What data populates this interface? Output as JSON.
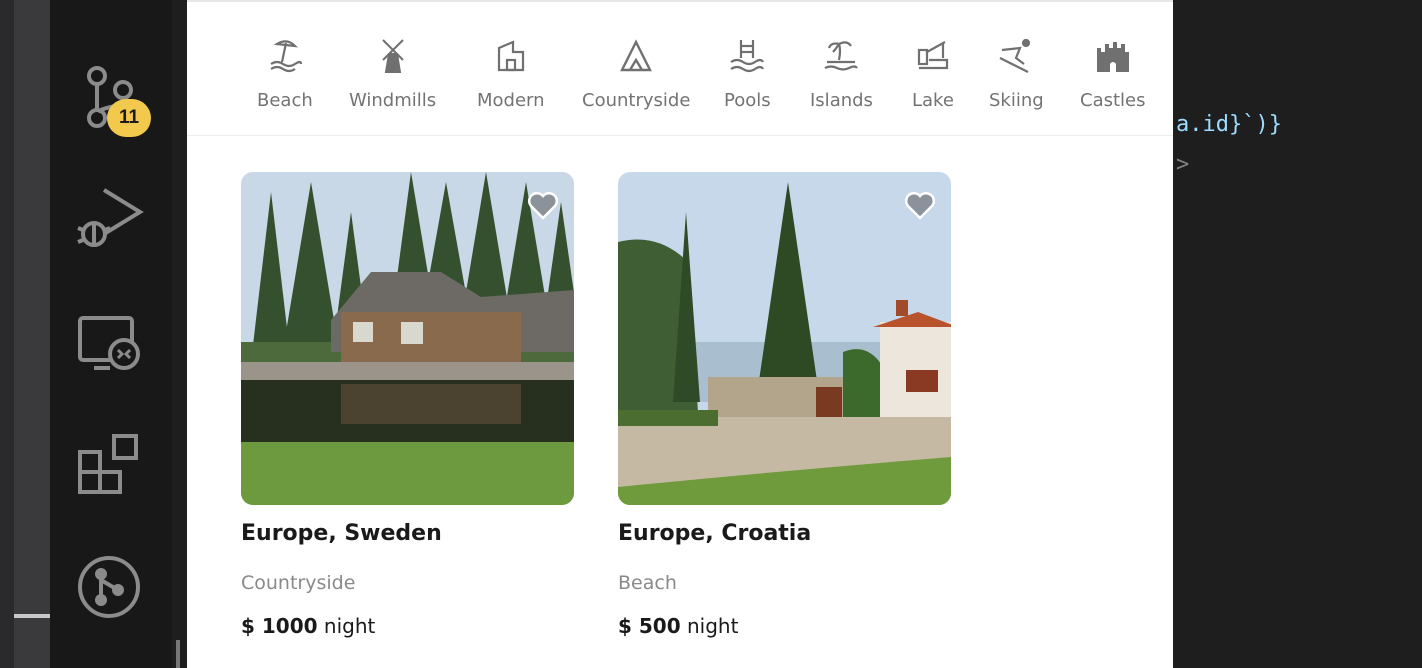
{
  "activity_bar": {
    "source_control_badge": "11",
    "icons": [
      "source-control-icon",
      "run-debug-icon",
      "remote-explorer-icon",
      "extensions-icon",
      "git-graph-icon"
    ]
  },
  "preview": {
    "categories": [
      {
        "label": "Beach",
        "icon": "beach-icon"
      },
      {
        "label": "Windmills",
        "icon": "windmill-icon"
      },
      {
        "label": "Modern",
        "icon": "modern-building-icon"
      },
      {
        "label": "Countryside",
        "icon": "mountain-icon"
      },
      {
        "label": "Pools",
        "icon": "pool-icon"
      },
      {
        "label": "Islands",
        "icon": "island-icon"
      },
      {
        "label": "Lake",
        "icon": "lake-icon"
      },
      {
        "label": "Skiing",
        "icon": "skiing-icon"
      },
      {
        "label": "Castles",
        "icon": "castle-icon"
      }
    ],
    "listings": [
      {
        "location": "Europe, Sweden",
        "category": "Countryside",
        "price": "$ 1000",
        "unit": "night"
      },
      {
        "location": "Europe, Croatia",
        "category": "Beach",
        "price": "$ 500",
        "unit": "night"
      }
    ]
  },
  "editor": {
    "code_fragment": "a.id}`)}",
    "code_line2": ">"
  },
  "colors": {
    "badge": "#f2c94c",
    "editor_bg": "#1e1e1e",
    "activity_bg": "#181818"
  }
}
